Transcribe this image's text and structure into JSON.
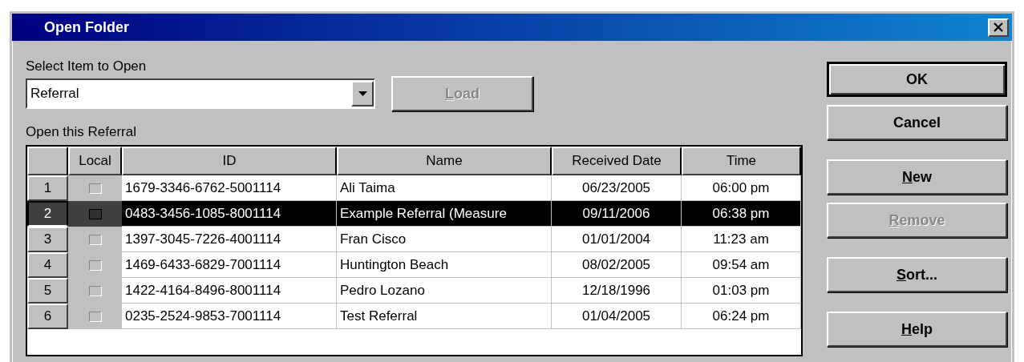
{
  "window": {
    "title": "Open Folder"
  },
  "select_label": "Select Item to Open",
  "select": {
    "value": "Referral"
  },
  "load_button": {
    "label": "Load",
    "disabled": true,
    "mnemonic": true
  },
  "list_label": "Open this Referral",
  "table": {
    "columns": [
      "Local",
      "ID",
      "Name",
      "Received Date",
      "Time"
    ],
    "rows": [
      {
        "number": "1",
        "local": false,
        "selected": false,
        "id": "1679-3346-6762-5001114",
        "name": "Ali Taima",
        "date": "06/23/2005",
        "time": "06:00 pm"
      },
      {
        "number": "2",
        "local": false,
        "selected": true,
        "id": "0483-3456-1085-8001114",
        "name": "Example Referral (Measure",
        "date": "09/11/2006",
        "time": "06:38 pm"
      },
      {
        "number": "3",
        "local": false,
        "selected": false,
        "id": "1397-3045-7226-4001114",
        "name": "Fran Cisco",
        "date": "01/01/2004",
        "time": "11:23 am"
      },
      {
        "number": "4",
        "local": false,
        "selected": false,
        "id": "1469-6433-6829-7001114",
        "name": "Huntington Beach",
        "date": "08/02/2005",
        "time": "09:54 am"
      },
      {
        "number": "5",
        "local": false,
        "selected": false,
        "id": "1422-4164-8496-8001114",
        "name": "Pedro Lozano",
        "date": "12/18/1996",
        "time": "01:03 pm"
      },
      {
        "number": "6",
        "local": false,
        "selected": false,
        "id": "0235-2524-9853-7001114",
        "name": "Test Referral",
        "date": "01/04/2005",
        "time": "06:24 pm"
      }
    ]
  },
  "button_groups": [
    [
      {
        "label": "OK",
        "disabled": false,
        "mnemonic": false,
        "default": true
      },
      {
        "label": "Cancel",
        "disabled": false,
        "mnemonic": false,
        "default": false
      }
    ],
    [
      {
        "label": "New",
        "disabled": false,
        "mnemonic": true,
        "default": false
      },
      {
        "label": "Remove",
        "disabled": true,
        "mnemonic": true,
        "default": false
      }
    ],
    [
      {
        "label": "Sort...",
        "disabled": false,
        "mnemonic": true,
        "default": false
      }
    ],
    [
      {
        "label": "Help",
        "disabled": false,
        "mnemonic": true,
        "default": false
      }
    ]
  ]
}
